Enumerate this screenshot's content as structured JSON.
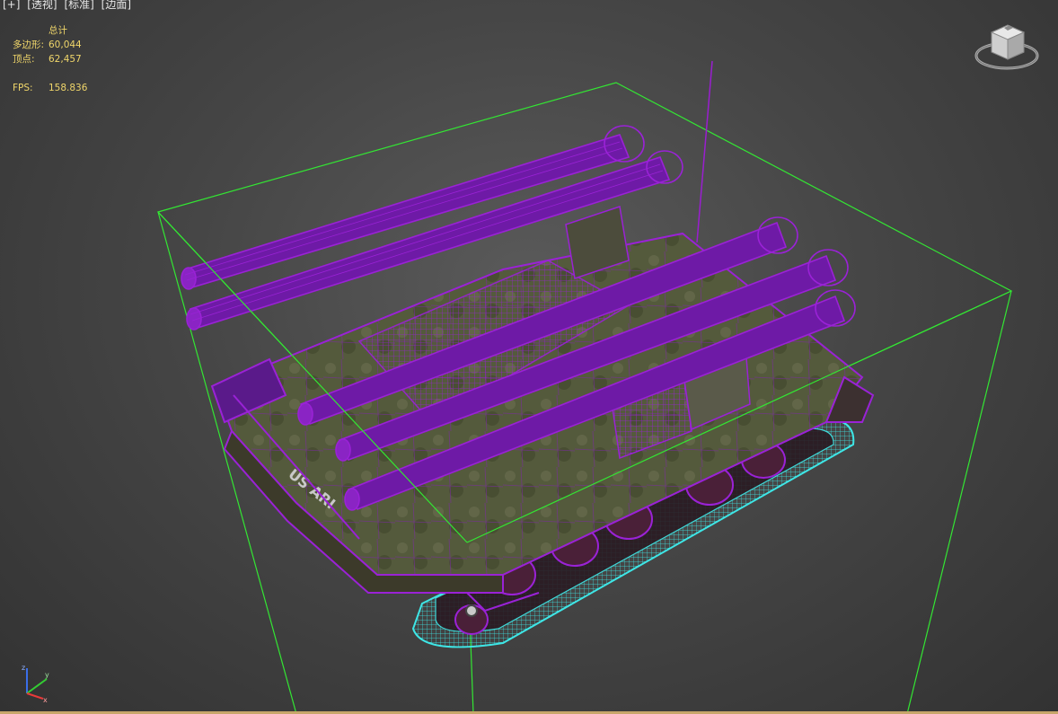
{
  "viewport": {
    "menu": [
      "[+]",
      "[透视]",
      "[标准]",
      "[边面]"
    ],
    "stats": {
      "header": "总计",
      "polygons_label": "多边形:",
      "polygons_value": "60,044",
      "vertices_label": "顶点:",
      "vertices_value": "62,457",
      "fps_label": "FPS:",
      "fps_value": "158.836"
    },
    "decal_text": "US ARI",
    "colors": {
      "wireframe": "#8a18c8",
      "bounding_box": "#33e633",
      "track_wire": "#3ee6e6",
      "stats_text": "#f0d66a",
      "background": "#464646"
    }
  },
  "icons": {
    "view_cube": "view-cube-icon",
    "axis_gizmo": "axis-gizmo-icon"
  }
}
